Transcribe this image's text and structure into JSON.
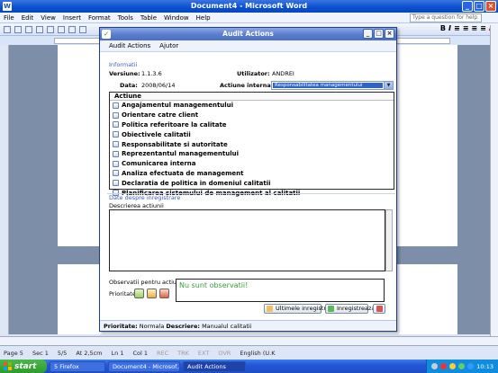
{
  "word": {
    "title": "Document4 - Microsoft Word",
    "menu": [
      "File",
      "Edit",
      "View",
      "Insert",
      "Format",
      "Tools",
      "Table",
      "Window",
      "Help"
    ],
    "help_placeholder": "Type a question for help",
    "format_buttons": [
      "B",
      "I"
    ],
    "status": {
      "page": "Page 5",
      "sec": "Sec 1",
      "pages": "5/5",
      "at": "At 2,5cm",
      "ln": "Ln 1",
      "col": "Col 1",
      "rec": "REC",
      "trk": "TRK",
      "ext": "EXT",
      "ovr": "OVR",
      "lang": "English (U.K"
    }
  },
  "taskbar": {
    "start": "start",
    "tasks": [
      "5 Firefox",
      "Document4 - Microsof...",
      "Audit Actions"
    ],
    "clock": "10:13"
  },
  "dialog": {
    "title": "Audit Actions",
    "menu": [
      "Audit Actions",
      "Ajutor"
    ],
    "info": {
      "section": "Informatii",
      "version_label": "Versiune:",
      "version_value": "1.1.3.6",
      "user_label": "Utilizator:",
      "user_value": "ANDREI",
      "date_label": "Data:",
      "date_value": "2008/06/14",
      "internal_label": "Actiune interna:",
      "internal_value": "Responsabilitatea managementului"
    },
    "actions_header": "Actiune",
    "actions": [
      "Angajamentul managementului",
      "Orientare catre client",
      "Politica referitoare la calitate",
      "Obiectivele calitatii",
      "Responsabilitate si autoritate",
      "Reprezentantul managementului",
      "Comunicarea interna",
      "Analiza efectuata de management",
      "Declaratia de politica in domeniul calitatii",
      "Planificarea sistemului de management al calitatii"
    ],
    "registration": {
      "section": "Date despre inregistrare",
      "description_label": "Descrierea actiunii",
      "description_value": "",
      "observations_label": "Observatii pentru actiune:",
      "observations_value": "Nu sunt observatii!",
      "priority_label": "Prioritate:"
    },
    "buttons": {
      "last_records": "Ultimele inregistrari",
      "save": "Inregistreaza"
    },
    "status": {
      "priority_label": "Prioritate:",
      "priority_value": "Normala",
      "description_label": "Descriere:",
      "description_value": "Manualul calitatii"
    }
  },
  "colors": {
    "titlebar": "#0a4fd0",
    "dialog_titlebar": "#5c7fcf",
    "section_title": "#3c5fb0",
    "observation_text": "#3a9a3a",
    "selection": "#3163c5"
  }
}
